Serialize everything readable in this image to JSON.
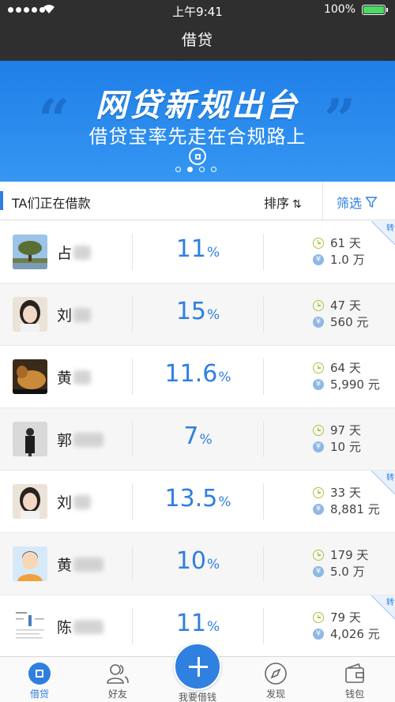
{
  "status_bar": {
    "time": "上午9:41",
    "battery": "100%"
  },
  "header": {
    "title": "借贷"
  },
  "banner": {
    "title": "网贷新规出台",
    "subtitle": "借贷宝率先走在合规路上",
    "page_count": 4,
    "active_page": 2
  },
  "filter_bar": {
    "title": "TA们正在借款",
    "sort_label": "排序",
    "sort_icon": "sort-arrows-icon",
    "filter_label": "筛选",
    "filter_icon": "funnel-icon"
  },
  "loans": [
    {
      "surname": "占",
      "rate": "11",
      "pct": "%",
      "days": "61 天",
      "amount": "1.0 万",
      "transfer": "转",
      "avatar": "tree-photo"
    },
    {
      "surname": "刘",
      "rate": "15",
      "pct": "%",
      "days": "47 天",
      "amount": "560 元",
      "transfer": "",
      "avatar": "woman-photo"
    },
    {
      "surname": "黄",
      "rate": "11.6",
      "pct": "%",
      "days": "64 天",
      "amount": "5,990 元",
      "transfer": "",
      "avatar": "dog-photo"
    },
    {
      "surname": "郭",
      "rate": "7",
      "pct": "%",
      "days": "97 天",
      "amount": "10 元",
      "transfer": "",
      "avatar": "man-photo"
    },
    {
      "surname": "刘",
      "rate": "13.5",
      "pct": "%",
      "days": "33 天",
      "amount": "8,881 元",
      "transfer": "转",
      "avatar": "woman-photo"
    },
    {
      "surname": "黄",
      "rate": "10",
      "pct": "%",
      "days": "179 天",
      "amount": "5.0 万",
      "transfer": "",
      "avatar": "default-avatar"
    },
    {
      "surname": "陈",
      "rate": "11",
      "pct": "%",
      "days": "79 天",
      "amount": "4,026 元",
      "transfer": "转",
      "avatar": "document-photo"
    }
  ],
  "tabbar": {
    "items": [
      {
        "label": "借贷",
        "icon": "borrow-icon",
        "active": true
      },
      {
        "label": "好友",
        "icon": "friends-icon",
        "active": false
      },
      {
        "label": "我要借钱",
        "icon": "plus-icon",
        "active": false
      },
      {
        "label": "发现",
        "icon": "compass-icon",
        "active": false
      },
      {
        "label": "钱包",
        "icon": "wallet-icon",
        "active": false
      }
    ]
  },
  "colors": {
    "accent": "#2f7fe0",
    "header_bg": "#2f2f2f",
    "clock_icon": "#a6c63f",
    "yen_icon": "#8fb8e6"
  }
}
